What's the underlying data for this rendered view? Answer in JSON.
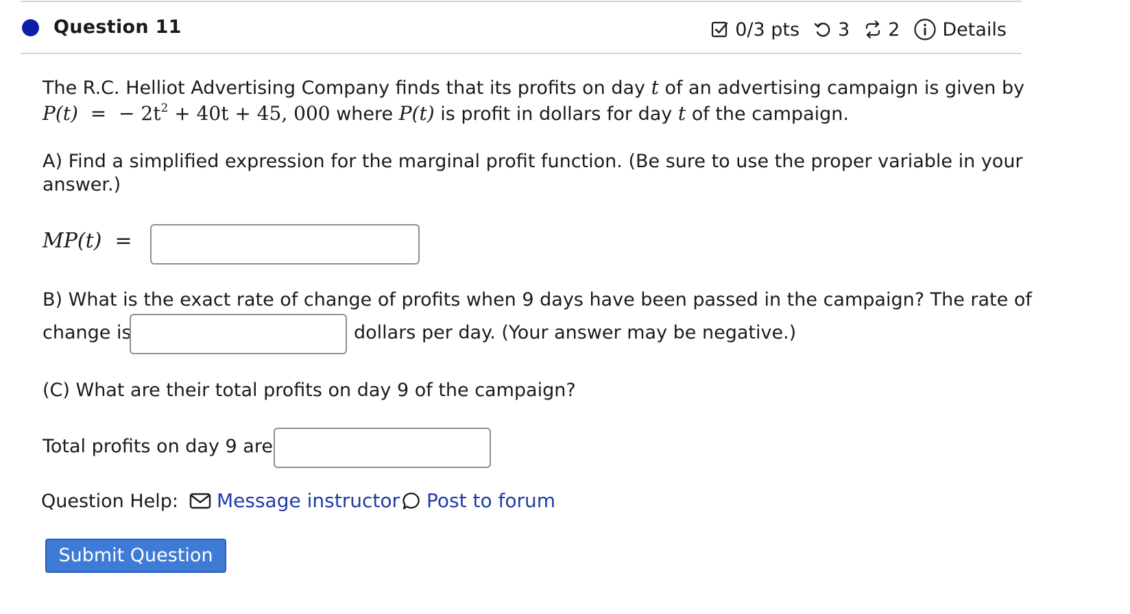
{
  "question": {
    "title": "Question 11",
    "points": "0/3 pts",
    "retries": "3",
    "attempts": "2",
    "details_label": "Details"
  },
  "intro": {
    "line1": "The R.C. Helliot Advertising Company finds that its profits on day",
    "line1_var": "t",
    "line1_end": "of an advertising campaign is given by",
    "line2_where": "where",
    "line2_mid": "is profit in dollars for day",
    "line2_var": "t",
    "line2_end": "of the campaign."
  },
  "formula": {
    "lhs": "P(t)",
    "equals": "=",
    "rhs_a": "− 2t",
    "rhs_exp": "2",
    "rhs_b": " + 40t + 45, 000",
    "pt": "P(t)"
  },
  "part_a": {
    "prompt": "A) Find a simplified expression for the marginal profit function. (Be sure to use the proper variable in your",
    "prompt_cont": "answer.)",
    "label": "MP(t)",
    "equals": "=",
    "value": ""
  },
  "part_b": {
    "prompt": "B) What is the exact rate of change of profits when 9 days have been passed in the campaign? The rate of",
    "prefix": "change is",
    "suffix": "dollars per day. (Your answer may be negative.)",
    "value": ""
  },
  "part_c": {
    "prompt": "(C) What are their total profits on day 9 of the campaign?",
    "label": "Total profits on day 9 are",
    "value": ""
  },
  "help": {
    "label": "Question Help:",
    "message_link": "Message instructor",
    "forum_link": "Post to forum"
  },
  "submit_label": "Submit Question",
  "colors": {
    "dot": "#0d1fa8",
    "link": "#1f3ca6",
    "button": "#3e7bd6"
  }
}
